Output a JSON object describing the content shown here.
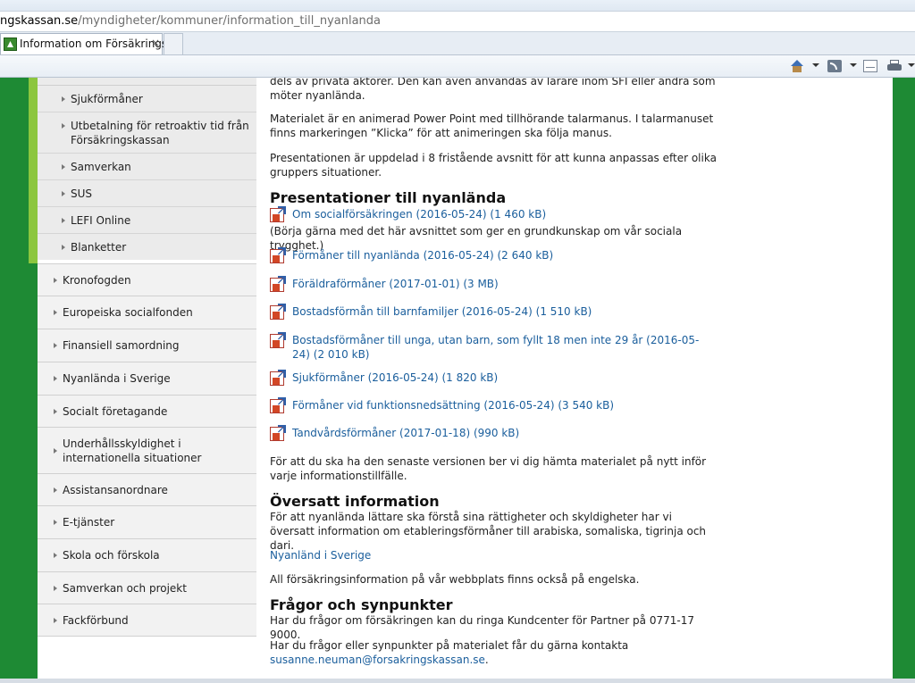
{
  "browser": {
    "url_domain": "ngskassan.se",
    "url_path": "/myndigheter/kommuner/information_till_nyanlanda",
    "tab_title": "Information om Försäkrings...",
    "tab_close": "×"
  },
  "sidebar": {
    "sub_items": [
      {
        "label": "Sjukförmåner"
      },
      {
        "label": "Utbetalning för retroaktiv tid från Försäkringskassan"
      },
      {
        "label": "Samverkan"
      },
      {
        "label": "SUS"
      },
      {
        "label": "LEFI Online"
      },
      {
        "label": "Blanketter"
      }
    ],
    "main_items": [
      {
        "label": "Kronofogden"
      },
      {
        "label": "Europeiska socialfonden"
      },
      {
        "label": "Finansiell samordning"
      },
      {
        "label": "Nyanlända i Sverige"
      },
      {
        "label": "Socialt företagande"
      },
      {
        "label": "Underhållsskyldighet i internationella situationer"
      },
      {
        "label": "Assistansanordnare"
      },
      {
        "label": "E-tjänster"
      },
      {
        "label": "Skola och förskola"
      },
      {
        "label": "Samverkan och projekt"
      },
      {
        "label": "Fackförbund"
      }
    ]
  },
  "content": {
    "intro_cut": "dels av privata aktörer. Den kan även användas av lärare inom SFI eller andra som möter nyanlända.",
    "intro_p2": "Materialet är en animerad Power Point med tillhörande talarmanus. I talarmanuset finns markeringen ”Klicka” för att animeringen ska följa manus.",
    "intro_p3": "Presentationen är uppdelad i 8 fristående avsnitt för att kunna anpassas efter olika gruppers situationer.",
    "heading_presentations": "Presentationer till nyanlända",
    "downloads": [
      {
        "label": "Om socialförsäkringen (2016-05-24) (1 460 kB)"
      },
      {
        "label": "Förmåner till nyanlända (2016-05-24) (2 640 kB)"
      },
      {
        "label": "Föräldraförmåner (2017-01-01) (3 MB)"
      },
      {
        "label": "Bostadsförmån till barnfamiljer (2016-05-24) (1 510 kB)"
      },
      {
        "label": "Bostadsförmåner till unga, utan barn, som fyllt 18 men inte 29 år (2016-05-24) (2 010 kB)"
      },
      {
        "label": "Sjukförmåner (2016-05-24) (1 820 kB)"
      },
      {
        "label": "Förmåner vid funktionsnedsättning (2016-05-24) (3 540 kB)"
      },
      {
        "label": "Tandvårdsförmåner (2017-01-18) (990 kB)"
      }
    ],
    "first_download_note": "(Börja gärna med det här avsnittet som ger en grundkunskap om vår sociala trygghet.)",
    "latest_version_text": "För att du ska ha den senaste versionen ber vi dig hämta materialet på nytt inför varje informationstillfälle.",
    "heading_translated": "Översatt information",
    "translated_text": "För att nyanlända lättare ska förstå sina rättigheter och skyldigheter har vi översatt information om etableringsförmåner till arabiska, somaliska, tigrinja och dari.",
    "translated_link": "Nyanländ i Sverige",
    "english_text": "All försäkringsinformation på vår webbplats finns också på engelska.",
    "heading_questions": "Frågor och synpunkter",
    "questions_text": "Har du frågor om försäkringen kan du ringa Kundcenter för Partner på 0771-17 9000.",
    "contact_text": "Har du frågor eller synpunkter på materialet får du gärna kontakta",
    "contact_email": "susanne.neuman@forsakringskassan.se",
    "contact_period": "."
  }
}
